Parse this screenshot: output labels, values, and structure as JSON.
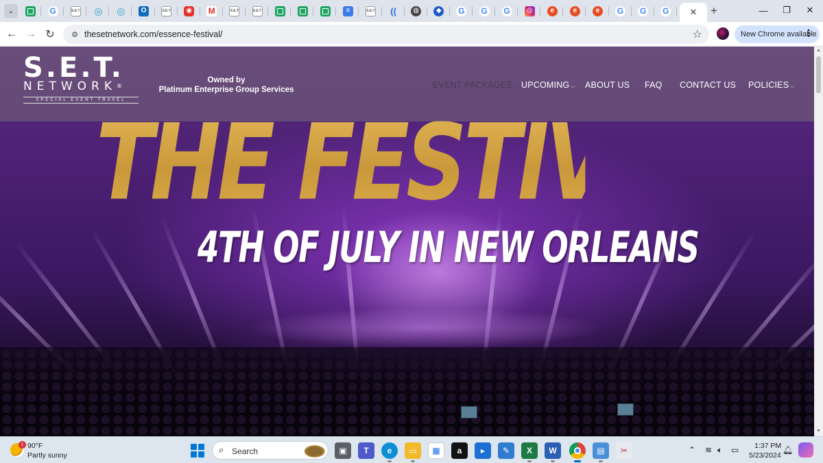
{
  "browser": {
    "tab_count_icons": [
      "sheets",
      "google",
      "set",
      "swirl",
      "swirl",
      "outlook",
      "set",
      "red-app",
      "gmail",
      "set",
      "set",
      "sheets",
      "sheets",
      "sheets",
      "docs",
      "set",
      "paren",
      "chrome",
      "dark",
      "google",
      "google",
      "google",
      "instagram",
      "e",
      "e",
      "e",
      "google",
      "google",
      "google"
    ],
    "new_tab_label": "+",
    "url": "thesetnetwork.com/essence-festival/",
    "update_label": "New Chrome available"
  },
  "site": {
    "logo_main": "S.E.T.",
    "logo_sub": "NETWORK",
    "logo_reg": "®",
    "logo_tag": "SPECIAL EVENT TRAVEL",
    "owned_by": "Owned by",
    "owner": "Platinum Enterprise Group Services",
    "nav": [
      {
        "label": "EVENT PACKAGES",
        "dropdown": true
      },
      {
        "label": "UPCOMING",
        "dropdown": true
      },
      {
        "label": "ABOUT US",
        "dropdown": false
      },
      {
        "label": "FAQ",
        "dropdown": false
      },
      {
        "label": "CONTACT US",
        "dropdown": false
      },
      {
        "label": "POLICIES",
        "dropdown": true
      }
    ],
    "hero_title": "THE FESTIVAL",
    "hero_subtitle": "4TH OF JULY IN NEW ORLEANS"
  },
  "taskbar": {
    "weather_badge": "1",
    "weather_temp": "90°F",
    "weather_condition": "Partly sunny",
    "search_label": "Search",
    "time": "1:37 PM",
    "date": "5/23/2024"
  },
  "colors": {
    "gold": "#d6a943",
    "purple": "#4a1f72",
    "chrome_update_bg": "#d3e3fd"
  }
}
